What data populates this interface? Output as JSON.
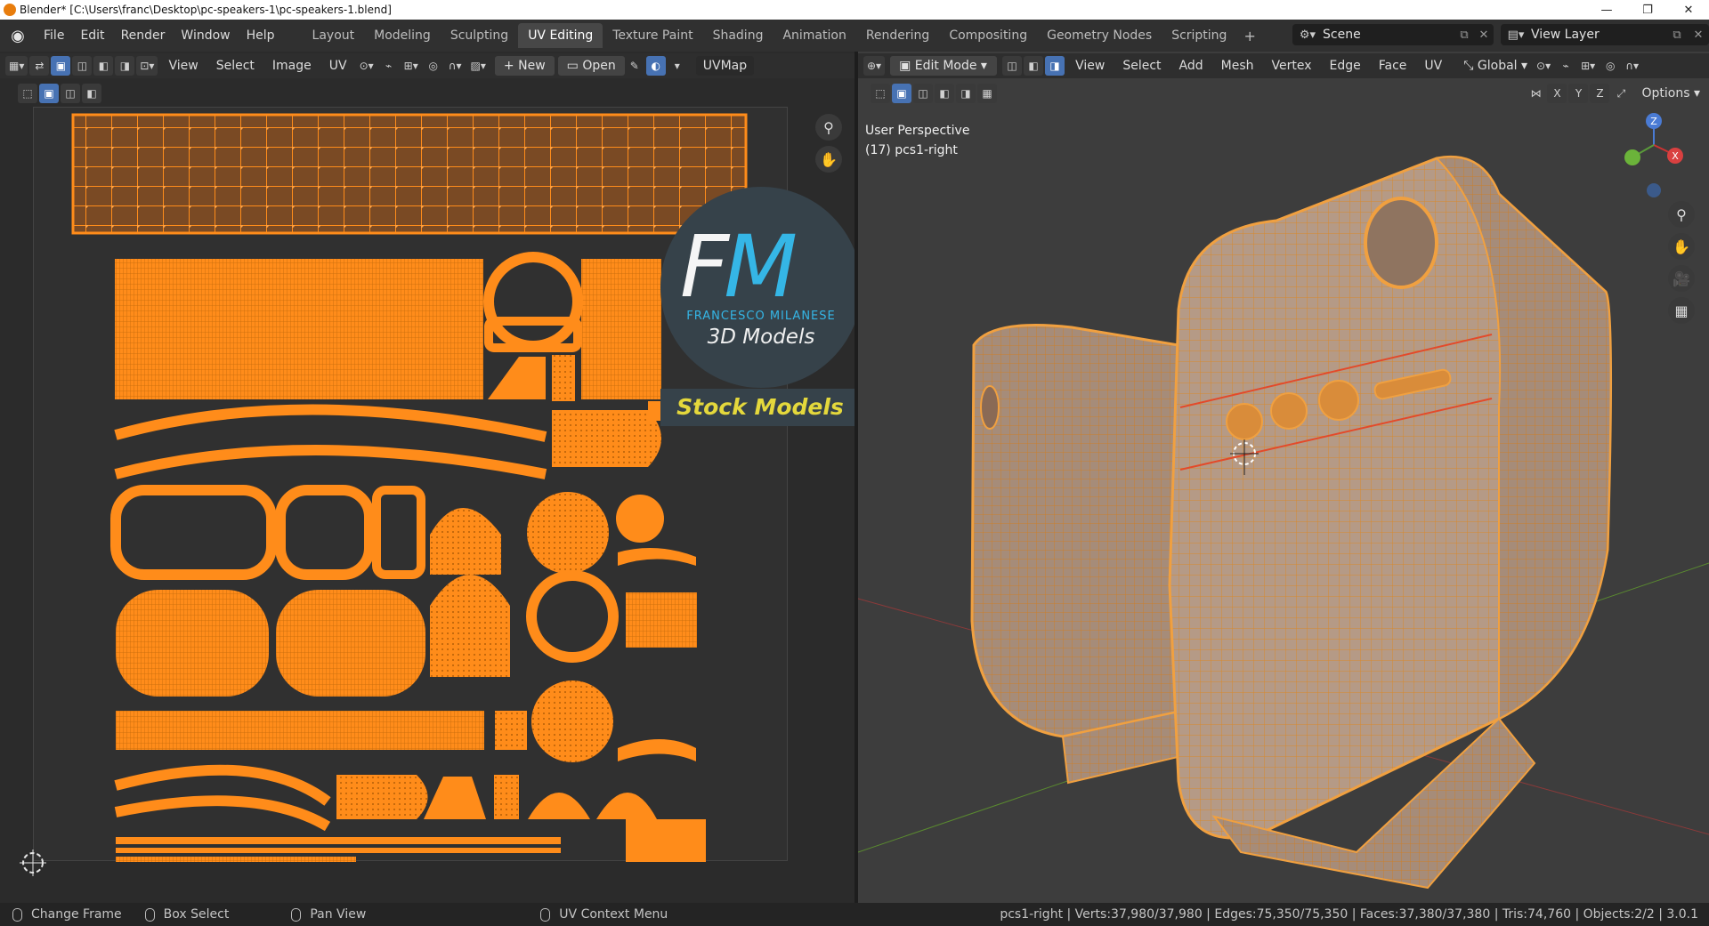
{
  "window": {
    "title": "Blender* [C:\\Users\\franc\\Desktop\\pc-speakers-1\\pc-speakers-1.blend]",
    "controls": [
      "—",
      "❐",
      "✕"
    ]
  },
  "topbar": {
    "menus": [
      "File",
      "Edit",
      "Render",
      "Window",
      "Help"
    ],
    "workspaces": [
      "Layout",
      "Modeling",
      "Sculpting",
      "UV Editing",
      "Texture Paint",
      "Shading",
      "Animation",
      "Rendering",
      "Compositing",
      "Geometry Nodes",
      "Scripting"
    ],
    "active_workspace": "UV Editing",
    "add_tab": "+",
    "scene": "Scene",
    "view_layer": "View Layer"
  },
  "uv_editor": {
    "menus": [
      "View",
      "Select",
      "Image",
      "UV"
    ],
    "new_label": "New",
    "open_label": "Open",
    "uvmap": "UVMap"
  },
  "viewport": {
    "mode": "Edit Mode",
    "menus": [
      "View",
      "Select",
      "Add",
      "Mesh",
      "Vertex",
      "Edge",
      "Face",
      "UV"
    ],
    "orientation": "Global",
    "options": "Options",
    "axes": [
      "X",
      "Y",
      "Z"
    ],
    "perspective": "User Perspective",
    "object_label": "(17) pcs1-right",
    "gizmo": {
      "z": "Z",
      "x": "X"
    }
  },
  "watermark": {
    "letters_f": "F",
    "letters_m": "M",
    "name": "FRANCESCO MILANESE",
    "sub": "3D Models",
    "badge": "Stock Models"
  },
  "statusbar": {
    "items": [
      "Change Frame",
      "Box Select",
      "Pan View",
      "UV Context Menu"
    ],
    "stats": "pcs1-right | Verts:37,980/37,980 | Edges:75,350/75,350 | Faces:37,380/37,380 | Tris:74,760 | Objects:2/2 | 3.0.1"
  },
  "colors": {
    "uv_orange": "#ff8c1a",
    "mesh_orange": "#f0a040",
    "accent_blue": "#4772b3",
    "fm_blue": "#35b6e6",
    "badge_yellow": "#e4d83c"
  }
}
